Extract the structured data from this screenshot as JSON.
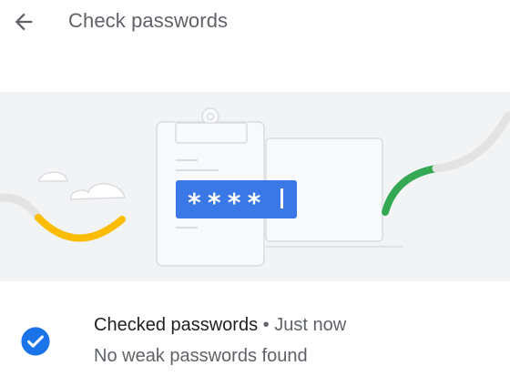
{
  "header": {
    "back_icon": "arrow-back-icon",
    "title": "Check passwords"
  },
  "illustration": {
    "masked_password": "****",
    "cursor": "|",
    "colors": {
      "background": "#f1f3f4",
      "outline": "#dadce0",
      "password_field": "#3b78e7",
      "wave_yellow": "#fbbc04",
      "wave_green": "#34a853",
      "wave_grey": "#e3e3e3"
    }
  },
  "status": {
    "icon": "check-circle-icon",
    "icon_color": "#1a73e8",
    "title": "Checked passwords",
    "separator": "•",
    "time": "Just now",
    "result": "No weak passwords found"
  }
}
